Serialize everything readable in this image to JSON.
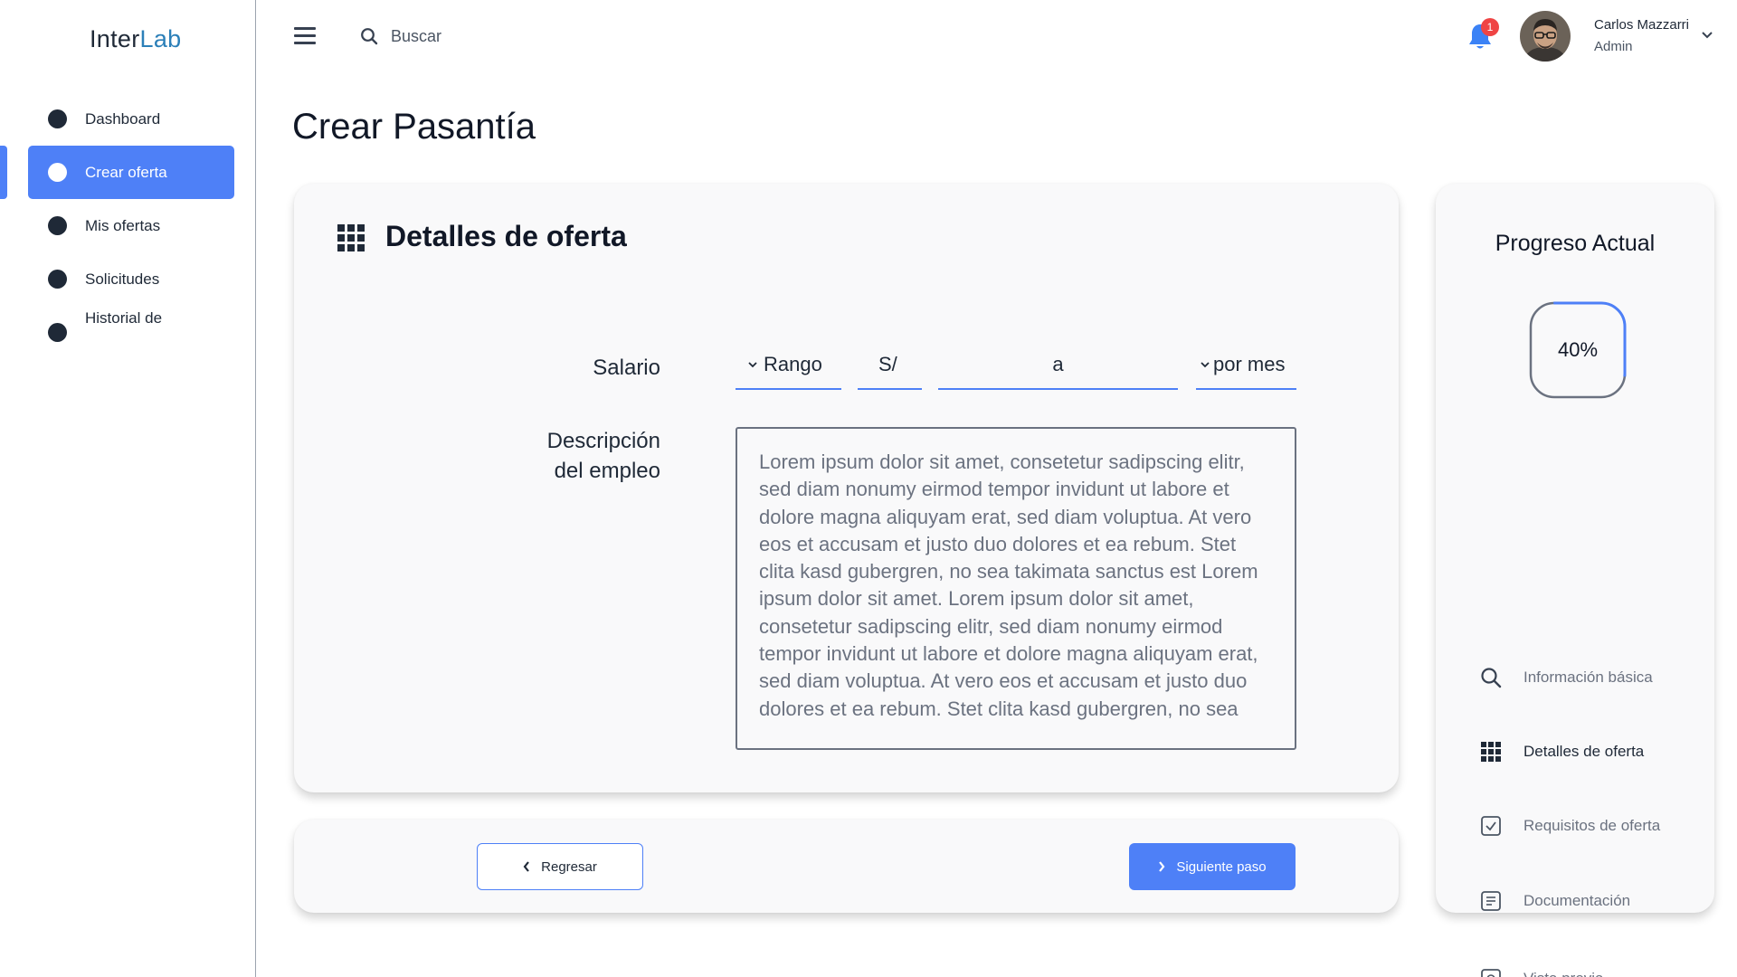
{
  "brand": {
    "part1": "Inter",
    "part2": "Lab"
  },
  "sidebar": {
    "items": [
      {
        "label": "Dashboard",
        "active": false
      },
      {
        "label": "Crear oferta",
        "active": true
      },
      {
        "label": "Mis ofertas",
        "active": false
      },
      {
        "label": "Solicitudes",
        "active": false
      },
      {
        "label": "Historial de",
        "active": false
      }
    ]
  },
  "topbar": {
    "search_placeholder": "Buscar",
    "notifications_count": "1",
    "user_name": "Carlos Mazzarri",
    "user_role": "Admin"
  },
  "page": {
    "title": "Crear Pasantía"
  },
  "form": {
    "section_title": "Detalles de oferta",
    "salary_label": "Salario",
    "salary_type": "Rango",
    "currency": "S/",
    "range_separator": "a",
    "period": "por mes",
    "description_label_line1": "Descripción",
    "description_label_line2": "del empleo",
    "description_text": "Lorem ipsum dolor sit amet, consetetur sadipscing elitr, sed diam nonumy eirmod tempor invidunt ut labore et dolore magna aliquyam erat, sed diam voluptua. At vero eos et accusam et justo duo dolores et ea rebum. Stet clita kasd gubergren, no sea takimata sanctus est Lorem ipsum dolor sit amet. Lorem ipsum dolor sit amet, consetetur sadipscing elitr, sed diam nonumy eirmod tempor invidunt ut labore et dolore magna aliquyam erat, sed diam voluptua. At vero eos et accusam et justo duo dolores et ea rebum. Stet clita kasd gubergren, no sea"
  },
  "footer": {
    "back_label": "Regresar",
    "next_label": "Siguiente paso"
  },
  "progress": {
    "title": "Progreso Actual",
    "value_label": "40%",
    "fraction": 0.4,
    "steps": [
      {
        "label": "Información básica",
        "icon": "search-icon",
        "active": false
      },
      {
        "label": "Detalles de oferta",
        "icon": "grid-icon",
        "active": true
      },
      {
        "label": "Requisitos de oferta",
        "icon": "checkbox-icon",
        "active": false
      },
      {
        "label": "Documentación",
        "icon": "document-icon",
        "active": false
      },
      {
        "label": "Vista previa",
        "icon": "preview-icon",
        "active": false
      }
    ]
  },
  "colors": {
    "accent": "#4e80f7",
    "brand": "#2b7fb8",
    "badge": "#ef4444",
    "bell": "#3b82f6"
  }
}
